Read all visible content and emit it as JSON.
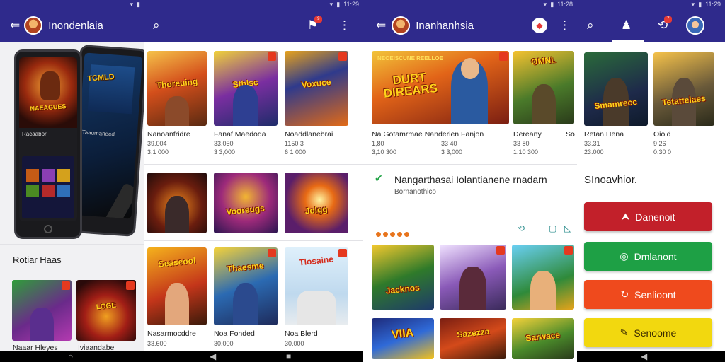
{
  "status": {
    "time": "11:29",
    "time2": "11:28",
    "time3": "11:28",
    "time4": "11:29"
  },
  "panel1": {
    "brand": "Inondenlaia",
    "phone_labels": [
      "Racaabor",
      "Taaumaneed"
    ],
    "section_title": "Rotiar Haas",
    "bottom_titles": [
      "Naaar Hleyes",
      "Iviaandabe"
    ]
  },
  "panel2": {
    "notif_count": "9",
    "tiles_word": [
      "Thoreuing",
      "Sthlsc",
      "Voxuce",
      "",
      "Vooreugs",
      "Jolgg",
      "Seaseool",
      "Thaesme",
      "Tlosaine"
    ],
    "row1": [
      {
        "title": "Nanoanfridre",
        "sub": "39.004"
      },
      {
        "title": "Fanaf Maedoda",
        "sub": "33.050"
      },
      {
        "title": "Noaddlanebrai",
        "sub": "1150 3"
      }
    ],
    "row1_sub2": [
      "3,1 000",
      "3 3,000",
      "6 1 000"
    ],
    "row3": [
      {
        "title": "Nasarmocddre",
        "sub": "33.600"
      },
      {
        "title": "Noa Fonded",
        "sub": "30.000"
      },
      {
        "title": "Noa Blerd",
        "sub": "30.000"
      }
    ]
  },
  "panel3": {
    "brand": "Inanhanhsia",
    "feature_word": "DURT DIREARS",
    "feature_top": "NEOEISCUNE REELLOE",
    "row1": [
      {
        "title": "Na Gotamrmae Nanderien Fanjon",
        "sub": "1,80",
        "sub2": "3,10 300"
      },
      {
        "title": "Dereany",
        "sub": "33 80",
        "sub2": "1.10 300"
      },
      {
        "title": "So",
        "sub": "",
        "sub2": ""
      }
    ],
    "row1_sub_mid": [
      "33 40",
      "3 3,000"
    ],
    "headline": "Nangarthasai Iolantianene rnadarn",
    "headline_sub": "Bornanothico",
    "row2_words": [
      "Jacknos",
      "",
      "",
      "VIIA",
      "Sazezza",
      "Sarwace"
    ]
  },
  "panel4": {
    "tiles_word": [
      "Smamrecc",
      "Tetattelaes"
    ],
    "items": [
      {
        "title": "Retan Hena",
        "sub": "33.31",
        "sub2": "23.000"
      },
      {
        "title": "Oiold",
        "sub": "9 26",
        "sub2": "0.30 0"
      }
    ],
    "section_title": "SInoavhior.",
    "notif_count": "7",
    "buttons": [
      {
        "label": "Danenoit",
        "color": "#c2202a",
        "icon": "arrow-up-icon"
      },
      {
        "label": "Dmlanont",
        "color": "#1ea045",
        "icon": "check-circle-icon"
      },
      {
        "label": "Senlioont",
        "color": "#ef4a1d",
        "icon": "refresh-icon"
      },
      {
        "label": "Senoome",
        "color": "#f2d80f",
        "icon": "tag-icon"
      }
    ]
  }
}
